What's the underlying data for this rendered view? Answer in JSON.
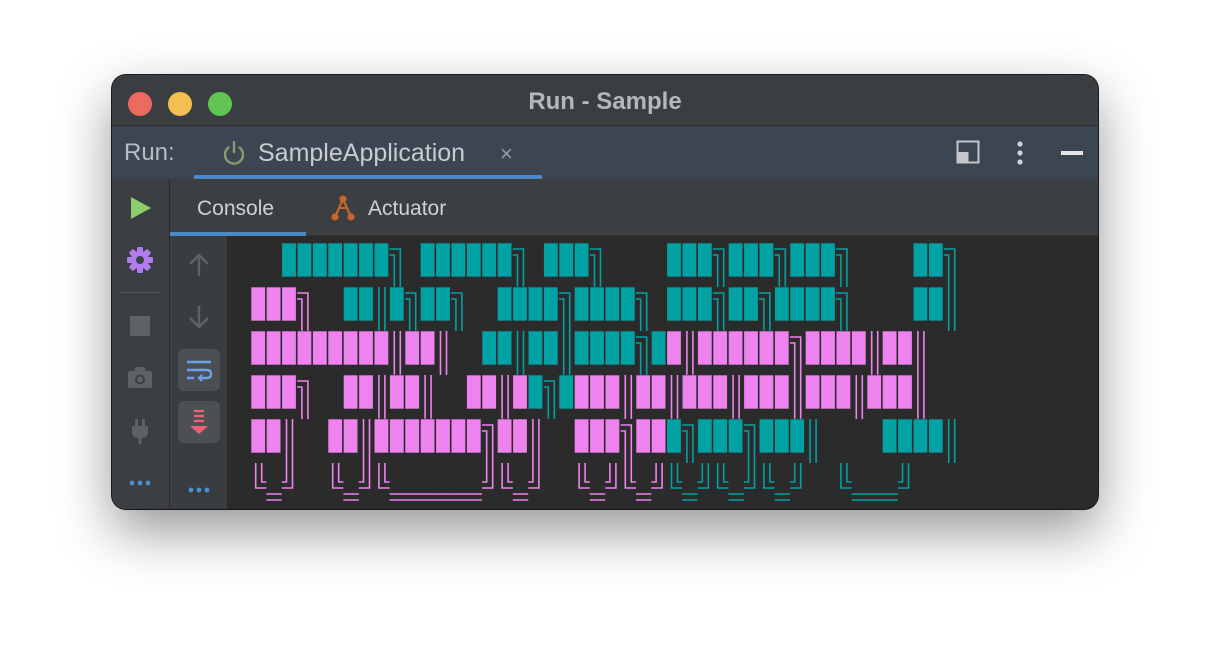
{
  "window": {
    "title": "Run - Sample"
  },
  "run_bar": {
    "label": "Run:",
    "tab_name": "SampleApplication",
    "close_glyph": "×",
    "tab_icon": "power-icon",
    "actions": [
      "layout-icon",
      "kebab-menu-icon",
      "minimize-icon"
    ]
  },
  "sub_tabs": [
    {
      "label": "Console",
      "active": true
    },
    {
      "label": "Actuator",
      "icon": "actuator-icon",
      "active": false
    }
  ],
  "left_toolbar": [
    "rerun-icon",
    "settings-icon",
    "stop-icon",
    "camera-icon",
    "plug-icon",
    "more-icon"
  ],
  "console_toolbar": [
    "up-arrow-icon",
    "down-arrow-icon",
    "soft-wrap-icon",
    "scroll-to-end-icon",
    "more-icon"
  ],
  "colors": {
    "accent": "#4a88c7",
    "run_green": "#8ecc6c",
    "settings_purple": "#b07cf0",
    "banner_teal": "#00a2a3",
    "banner_pink": "#ee82ee",
    "actuator_orange": "#c8652f"
  },
  "console_banner": {
    "rows": [
      "  ███████╗ ██████╗ ███╗    ███╗███╗███╗    ██╗",
      "███╗  ██║█╗██╗  ████╗████╗ ███╗██╗████╗    ██║",
      "█████████║██║  ██║██║████╗██║██████╗████║██║",
      "███╗  ██║██║  ██║██╗████║██║███║███║███║███║",
      "██║  ██║███████╗██║  ███╗███╗███╗███║    ████║",
      "╚═╝  ╚═╝╚══════╝╚═╝  ╚═╝╚═╝╚═╝╚═╝╚═╝  ╚═══╝"
    ]
  }
}
